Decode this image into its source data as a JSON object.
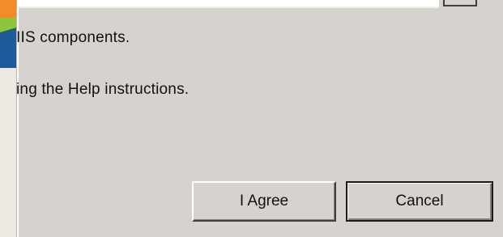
{
  "dialog": {
    "text_line_1": "IIS components.",
    "text_line_2": "ing the Help instructions.",
    "buttons": {
      "agree_label": "I Agree",
      "cancel_label": "Cancel"
    }
  },
  "colors": {
    "background": "#d6d3ce",
    "banner_orange": "#f28c28",
    "banner_green": "#8cc63e",
    "banner_blue": "#1e5a9a"
  }
}
